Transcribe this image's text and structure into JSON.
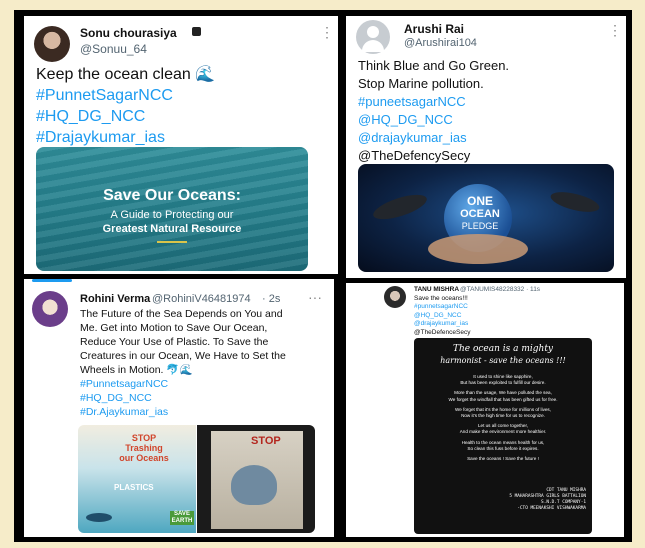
{
  "tweet1": {
    "name": "Sonu chourasiya",
    "handle": "@Sonuu_64",
    "text": "Keep the ocean clean",
    "hashtags": [
      "#PunnetSagarNCC",
      "#HQ_DG_NCC",
      "#Drajaykumar_ias"
    ],
    "card_title": "Save Our Oceans:",
    "card_subtitle_1": "A Guide to Protecting our",
    "card_subtitle_2": "Greatest Natural Resource"
  },
  "tweet2": {
    "name": "Arushi Rai",
    "handle": "@Arushirai104",
    "text_1": "Think Blue and Go Green.",
    "text_2": "Stop Marine pollution.",
    "tags": [
      "#puneetsagarNCC",
      "@HQ_DG_NCC",
      "@drajaykumar_ias",
      "@TheDefencySecy"
    ],
    "pledge_1": "ONE",
    "pledge_2": "OCEAN",
    "pledge_3": "PLEDGE"
  },
  "tweet3": {
    "name": "Rohini Verma",
    "handle": "@RohiniV46481974",
    "time": "· 2s",
    "lines": [
      "The Future of the Sea Depends on You and",
      "Me. Get into Motion to Save Our Ocean,",
      "Reduce Your Use of Plastic. To Save the",
      "Creatures in our Ocean, We Have to Set the",
      "Wheels in Motion."
    ],
    "hashtags": [
      "#PunnetsagarNCC",
      "#HQ_DG_NCC",
      "#Dr.Ajaykumar_ias"
    ],
    "poster_1": "STOP Trashing our Oceans",
    "poster_label": "PLASTICS",
    "poster_save": "SAVE EARTH",
    "poster_2": "STOP"
  },
  "tweet4": {
    "name": "TANU MISHRA",
    "handle": "@TANUMIS48228332 · 11s",
    "lines": [
      "Save the oceans!!!"
    ],
    "tags": [
      "#punnetsagarNCC",
      "@HQ_DG_NCC",
      "@drajaykumar_ias",
      "@TheDefenceSecy"
    ],
    "poem_title_1": "The ocean is a mighty",
    "poem_title_2": "harmonist - save the oceans !!!",
    "poem": [
      "It used to shine like sapphire,",
      "But has been exploited to fulfill our desire.",
      "",
      "More than the usage, We have polluted the sea,",
      "We forget the windfall that has been gifted us for free.",
      "",
      "We forget that it's the home for millions of lives,",
      "Now it's the high time for us to recognize.",
      "",
      "Let us all come together,",
      "And make the environment more healthier.",
      "",
      "Health to the ocean means health for us,",
      "So clean this fuss before it expires.",
      "",
      "Save the oceans ! Save the future !"
    ],
    "signature": [
      "CDT TANU MISHRA",
      "5 MAHARASHTRA GIRLS BATTALION",
      "S.N.D.T COMPANY-1",
      "-CTO MEENAKSHI VISHWAKARMA"
    ]
  },
  "colors": {
    "link": "#1d9bf0",
    "handle": "#536471",
    "frame": "#000000",
    "page_bg": "#f6ecc9"
  }
}
